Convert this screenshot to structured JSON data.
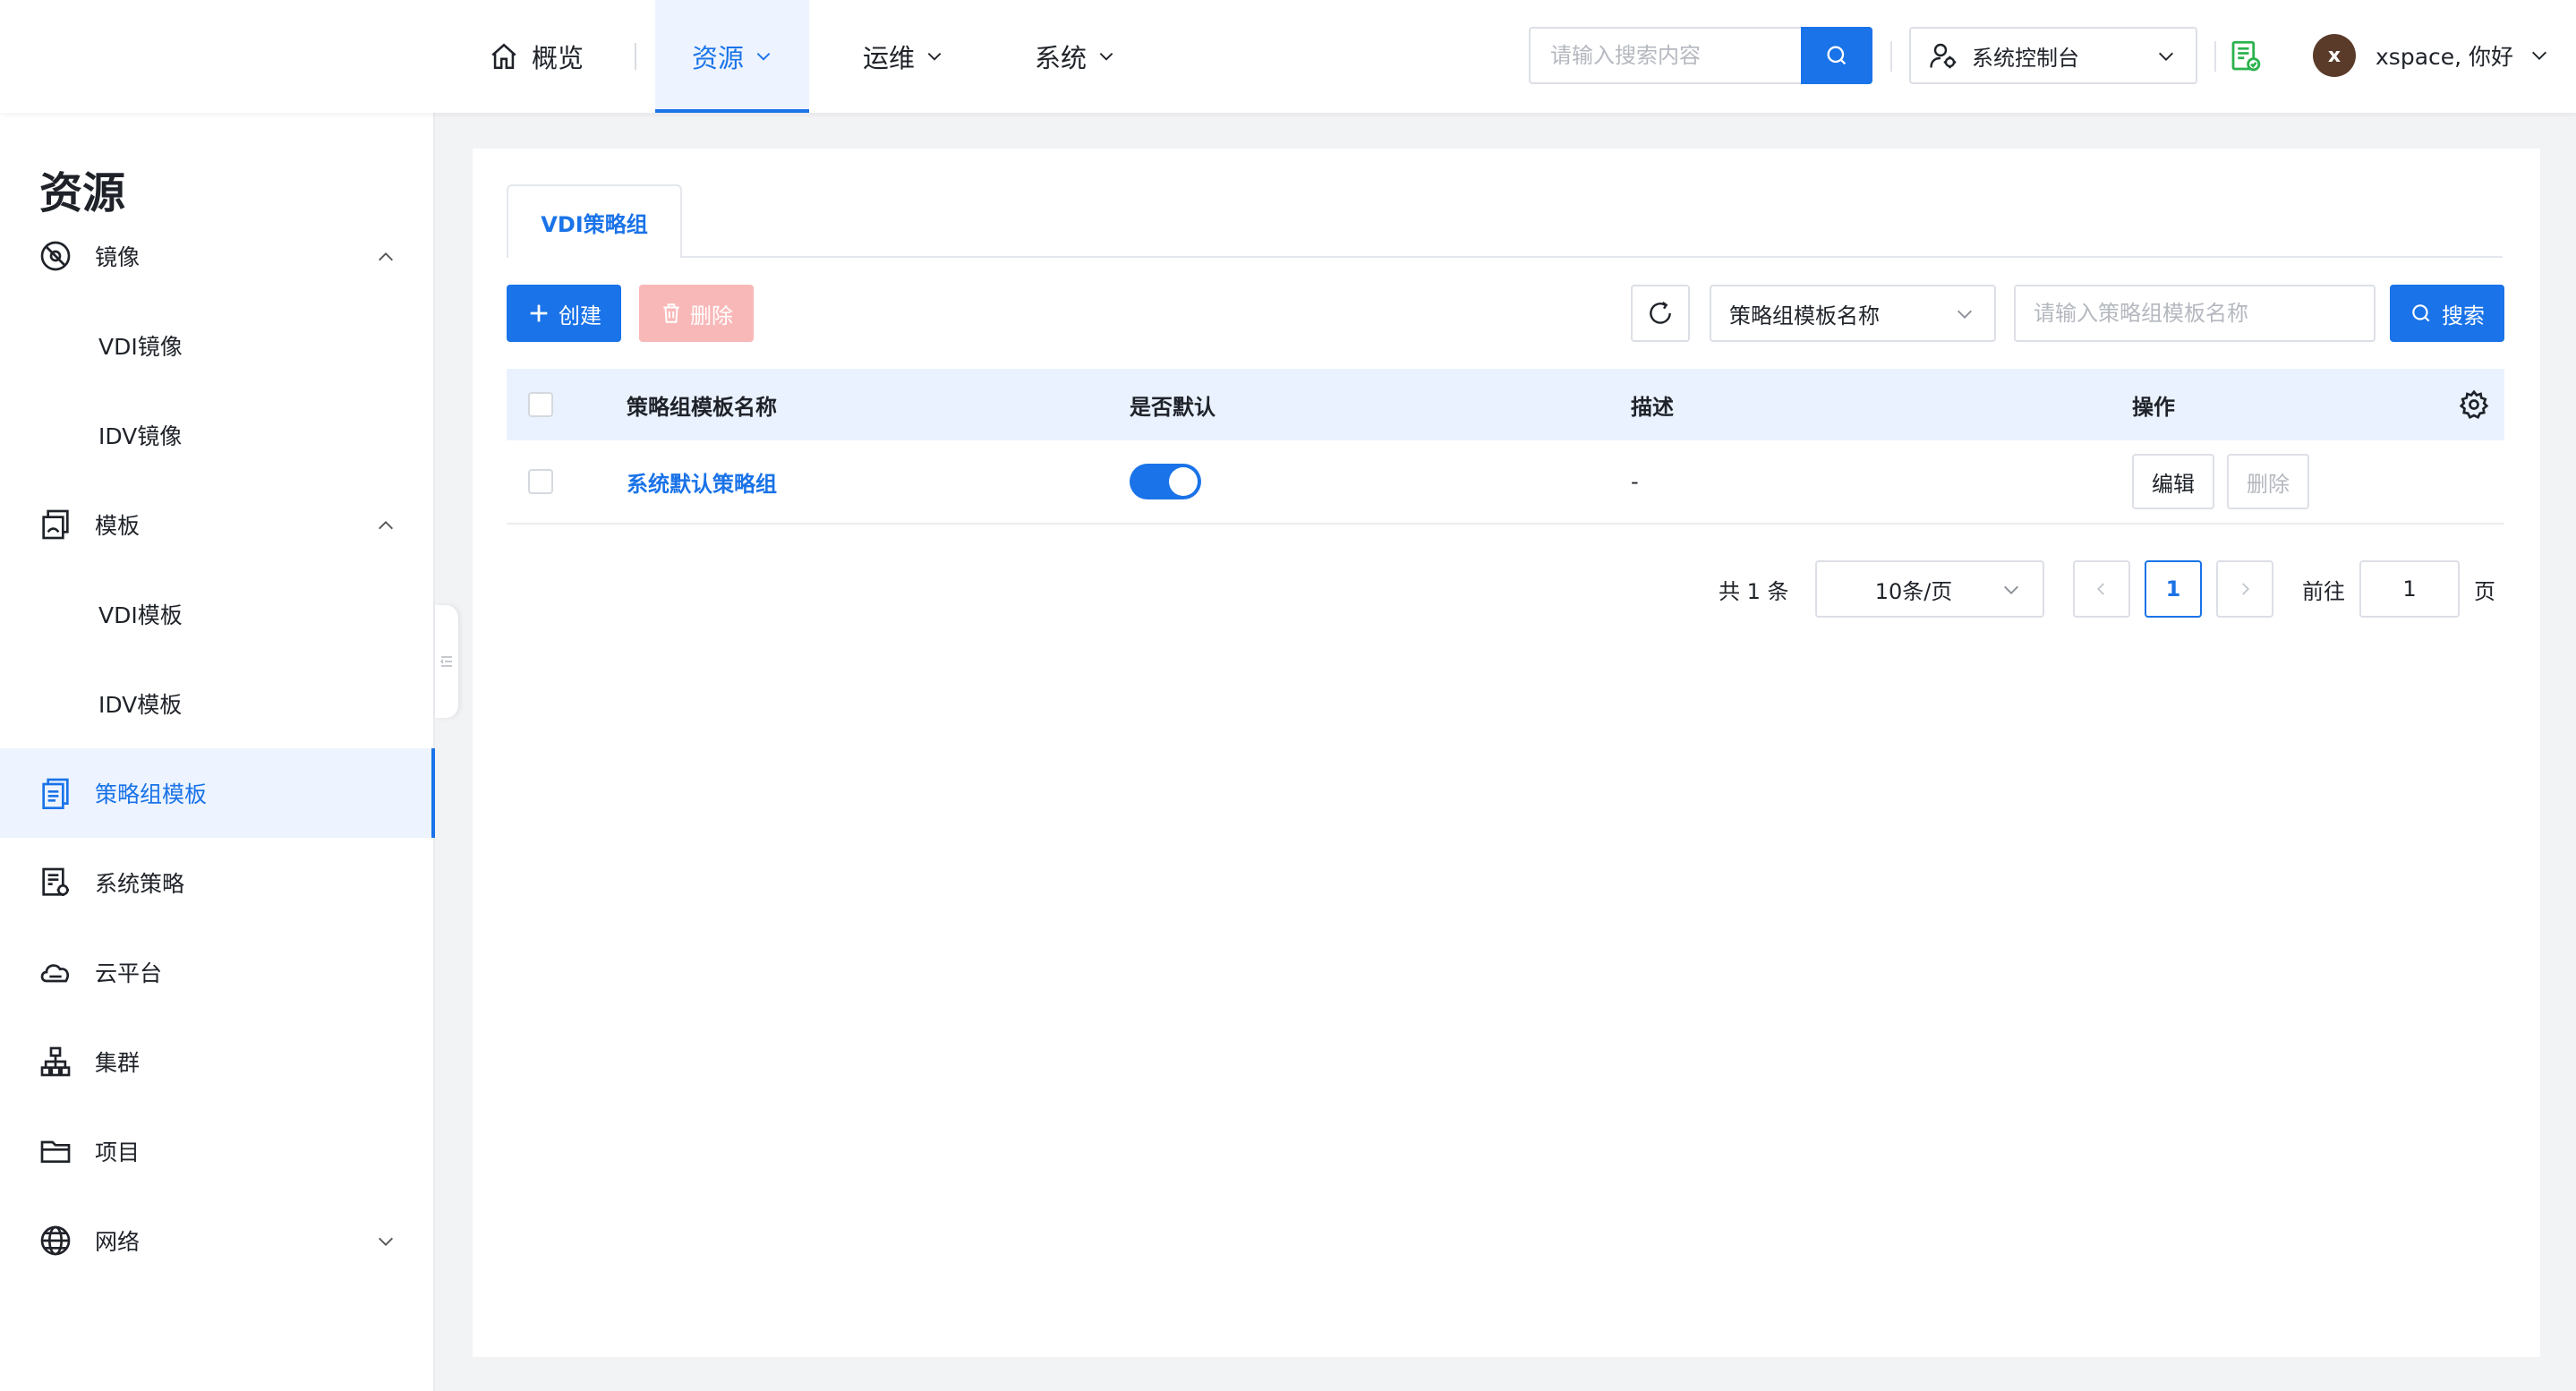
{
  "nav": {
    "home": "概览",
    "resources": "资源",
    "ops": "运维",
    "system": "系统"
  },
  "top_search": {
    "placeholder": "请输入搜索内容"
  },
  "console_select": {
    "value": "系统控制台"
  },
  "user": {
    "avatar_letter": "x",
    "greeting": "xspace, 你好"
  },
  "sidebar": {
    "title": "资源",
    "items": [
      {
        "label": "镜像",
        "icon": "image-icon",
        "expanded": true
      },
      {
        "label": "VDI镜像"
      },
      {
        "label": "IDV镜像"
      },
      {
        "label": "模板",
        "icon": "template-icon",
        "expanded": true
      },
      {
        "label": "VDI模板"
      },
      {
        "label": "IDV模板"
      },
      {
        "label": "策略组模板",
        "icon": "policy-template-icon",
        "active": true
      },
      {
        "label": "系统策略",
        "icon": "system-policy-icon"
      },
      {
        "label": "云平台",
        "icon": "cloud-icon"
      },
      {
        "label": "集群",
        "icon": "cluster-icon"
      },
      {
        "label": "项目",
        "icon": "folder-icon"
      },
      {
        "label": "网络",
        "icon": "globe-icon",
        "expanded": false
      }
    ]
  },
  "tabs": [
    {
      "label": "VDI策略组",
      "active": true
    }
  ],
  "toolbar": {
    "create": "创建",
    "delete": "删除",
    "field_select": "策略组模板名称",
    "search_placeholder": "请输入策略组模板名称",
    "search": "搜索"
  },
  "table": {
    "headers": [
      "策略组模板名称",
      "是否默认",
      "描述",
      "操作"
    ],
    "rows": [
      {
        "name": "系统默认策略组",
        "is_default": true,
        "description": "-",
        "actions": [
          "编辑",
          "删除"
        ]
      }
    ]
  },
  "pagination": {
    "total": "共 1 条",
    "page_size": "10条/页",
    "current_page": "1",
    "goto_label": "前往",
    "goto_value": "1",
    "page_unit": "页"
  },
  "colors": {
    "primary": "#1a73e8",
    "danger_disabled": "#f9b8b8",
    "header_bg": "#eaf2ff"
  }
}
